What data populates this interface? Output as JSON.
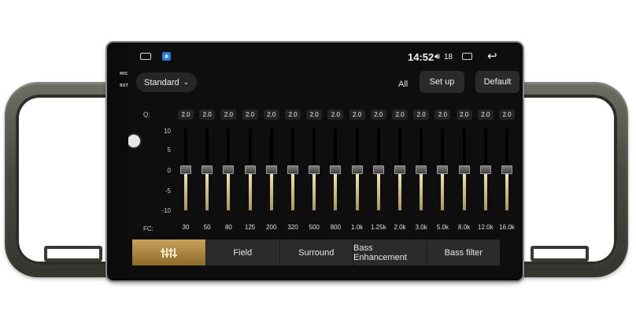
{
  "status": {
    "time": "14:52",
    "volume": "18"
  },
  "eq": {
    "preset": "Standard",
    "all_label": "All",
    "setup_label": "Set up",
    "default_label": "Default",
    "q_label": "Q:",
    "fc_label": "FC:",
    "scale": [
      "10",
      "5",
      "0",
      "-5",
      "-10"
    ],
    "bands": [
      {
        "q": "2.0",
        "fc": "30",
        "gain": 0
      },
      {
        "q": "2.0",
        "fc": "50",
        "gain": 0
      },
      {
        "q": "2.0",
        "fc": "80",
        "gain": 0
      },
      {
        "q": "2.0",
        "fc": "125",
        "gain": 0
      },
      {
        "q": "2.0",
        "fc": "200",
        "gain": 0
      },
      {
        "q": "2.0",
        "fc": "320",
        "gain": 0
      },
      {
        "q": "2.0",
        "fc": "500",
        "gain": 0
      },
      {
        "q": "2.0",
        "fc": "800",
        "gain": 0
      },
      {
        "q": "2.0",
        "fc": "1.0k",
        "gain": 0
      },
      {
        "q": "2.0",
        "fc": "1.25k",
        "gain": 0
      },
      {
        "q": "2.0",
        "fc": "2.0k",
        "gain": 0
      },
      {
        "q": "2.0",
        "fc": "3.0k",
        "gain": 0
      },
      {
        "q": "2.0",
        "fc": "5.0k",
        "gain": 0
      },
      {
        "q": "2.0",
        "fc": "8.0k",
        "gain": 0
      },
      {
        "q": "2.0",
        "fc": "12.0k",
        "gain": 0
      },
      {
        "q": "2.0",
        "fc": "16.0k",
        "gain": 0
      }
    ]
  },
  "tabs": [
    {
      "label": "",
      "icon": "equalizer-icon",
      "active": true
    },
    {
      "label": "Field"
    },
    {
      "label": "Surround"
    },
    {
      "label": "Bass Enhancement"
    },
    {
      "label": "Bass filter"
    }
  ],
  "hardware": {
    "mic_label": "MIC",
    "rst_label": "RST"
  },
  "colors": {
    "accent": "#c8a35a",
    "screen_bg": "#0e0e0e",
    "bezel": "#4b4a42"
  }
}
